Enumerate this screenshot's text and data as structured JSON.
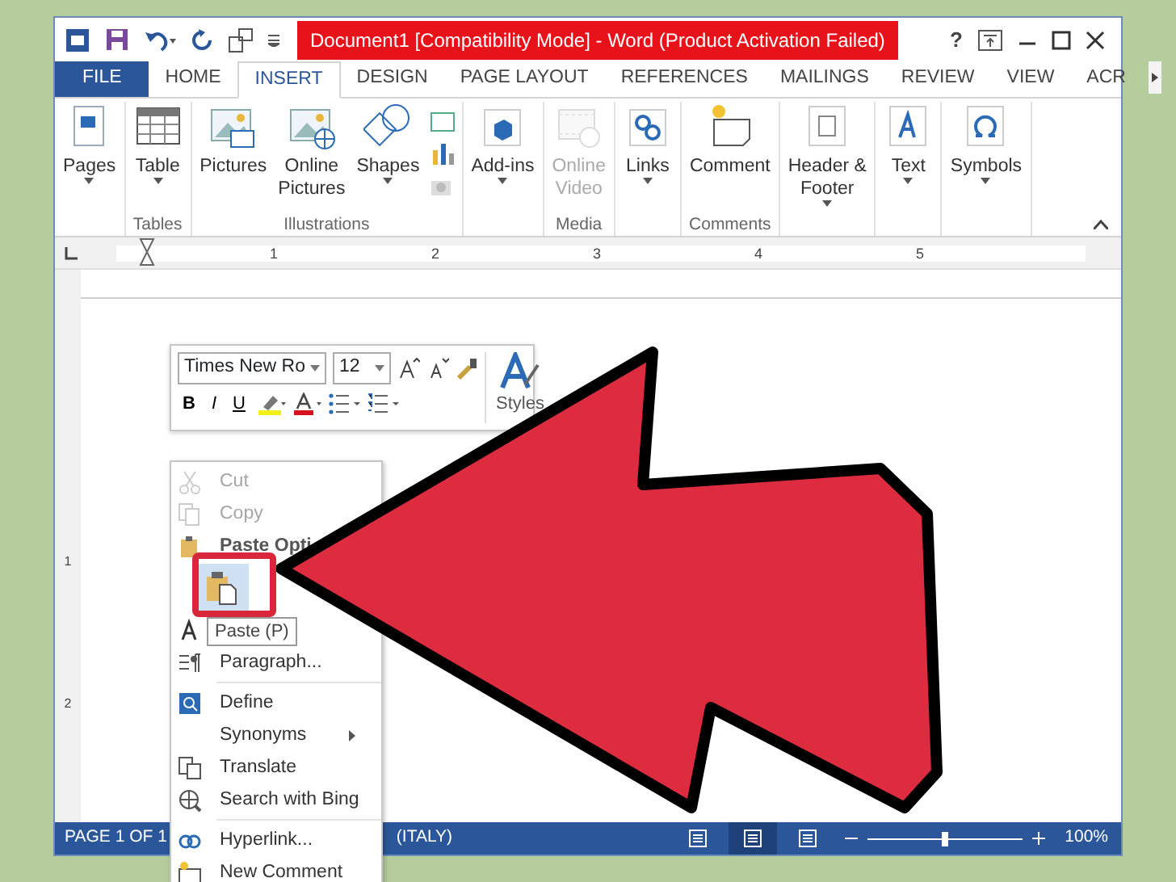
{
  "title_bar": {
    "title": "Document1 [Compatibility Mode] -  Word (Product Activation Failed)",
    "help": "?"
  },
  "tabs": [
    {
      "label": "FILE",
      "kind": "file",
      "selected": false
    },
    {
      "label": "HOME",
      "kind": "tab",
      "selected": false
    },
    {
      "label": "INSERT",
      "kind": "tab",
      "selected": true
    },
    {
      "label": "DESIGN",
      "kind": "tab",
      "selected": false
    },
    {
      "label": "PAGE LAYOUT",
      "kind": "tab",
      "selected": false
    },
    {
      "label": "REFERENCES",
      "kind": "tab",
      "selected": false
    },
    {
      "label": "MAILINGS",
      "kind": "tab",
      "selected": false
    },
    {
      "label": "REVIEW",
      "kind": "tab",
      "selected": false
    },
    {
      "label": "VIEW",
      "kind": "tab",
      "selected": false
    },
    {
      "label": "ACR",
      "kind": "tab",
      "selected": false
    }
  ],
  "ribbon_groups": [
    {
      "buttons": [
        {
          "label": "Pages",
          "dropdown": true,
          "disabled": false
        }
      ]
    },
    {
      "label": "Tables",
      "buttons": [
        {
          "label": "Table",
          "dropdown": true,
          "disabled": false
        }
      ]
    },
    {
      "label": "Illustrations",
      "buttons": [
        {
          "label": "Pictures",
          "dropdown": false,
          "disabled": false
        },
        {
          "label": "Online Pictures",
          "dropdown": false,
          "disabled": false
        },
        {
          "label": "Shapes",
          "dropdown": true,
          "disabled": false
        }
      ],
      "small_tools": true
    },
    {
      "buttons": [
        {
          "label": "Add-ins",
          "dropdown": true,
          "disabled": false
        }
      ]
    },
    {
      "label": "Media",
      "buttons": [
        {
          "label": "Online Video",
          "dropdown": false,
          "disabled": true
        }
      ]
    },
    {
      "buttons": [
        {
          "label": "Links",
          "dropdown": true,
          "disabled": false
        }
      ]
    },
    {
      "label": "Comments",
      "buttons": [
        {
          "label": "Comment",
          "dropdown": false,
          "disabled": false
        }
      ]
    },
    {
      "buttons": [
        {
          "label": "Header & Footer",
          "dropdown": true,
          "disabled": false
        }
      ]
    },
    {
      "buttons": [
        {
          "label": "Text",
          "dropdown": true,
          "disabled": false
        }
      ]
    },
    {
      "buttons": [
        {
          "label": "Symbols",
          "dropdown": true,
          "disabled": false
        }
      ]
    }
  ],
  "ruler": {
    "numbers": [
      "1",
      "2",
      "3",
      "4",
      "5"
    ],
    "vertical_numbers": [
      "1",
      "2"
    ]
  },
  "mini_toolbar": {
    "font": "Times New Ro",
    "size": "12",
    "styles_label": "Styles",
    "format_buttons": [
      "B",
      "I",
      "U"
    ]
  },
  "context_menu": [
    {
      "kind": "item",
      "label": "Cut",
      "disabled": true
    },
    {
      "kind": "item",
      "label": "Copy",
      "disabled": true
    },
    {
      "kind": "header",
      "label": "Paste Opti"
    },
    {
      "kind": "paste_row"
    },
    {
      "kind": "covered"
    },
    {
      "kind": "item",
      "label": "Paragraph...",
      "disabled": false
    },
    {
      "kind": "separator"
    },
    {
      "kind": "item",
      "label": "Define",
      "disabled": false
    },
    {
      "kind": "submenu",
      "label": "Synonyms",
      "disabled": false
    },
    {
      "kind": "item",
      "label": "Translate",
      "disabled": false
    },
    {
      "kind": "item",
      "label": "Search with Bing",
      "disabled": false
    },
    {
      "kind": "separator"
    },
    {
      "kind": "item",
      "label": "Hyperlink...",
      "disabled": false
    },
    {
      "kind": "item",
      "label": "New Comment",
      "disabled": false
    }
  ],
  "tooltip": "Paste (P)",
  "status_bar": {
    "page": "PAGE 1 OF 1",
    "language": "(ITALY)",
    "views": [
      {
        "selected": false
      },
      {
        "selected": true
      },
      {
        "selected": false
      }
    ],
    "zoom": {
      "level": 0.5,
      "reading": "100%"
    }
  }
}
